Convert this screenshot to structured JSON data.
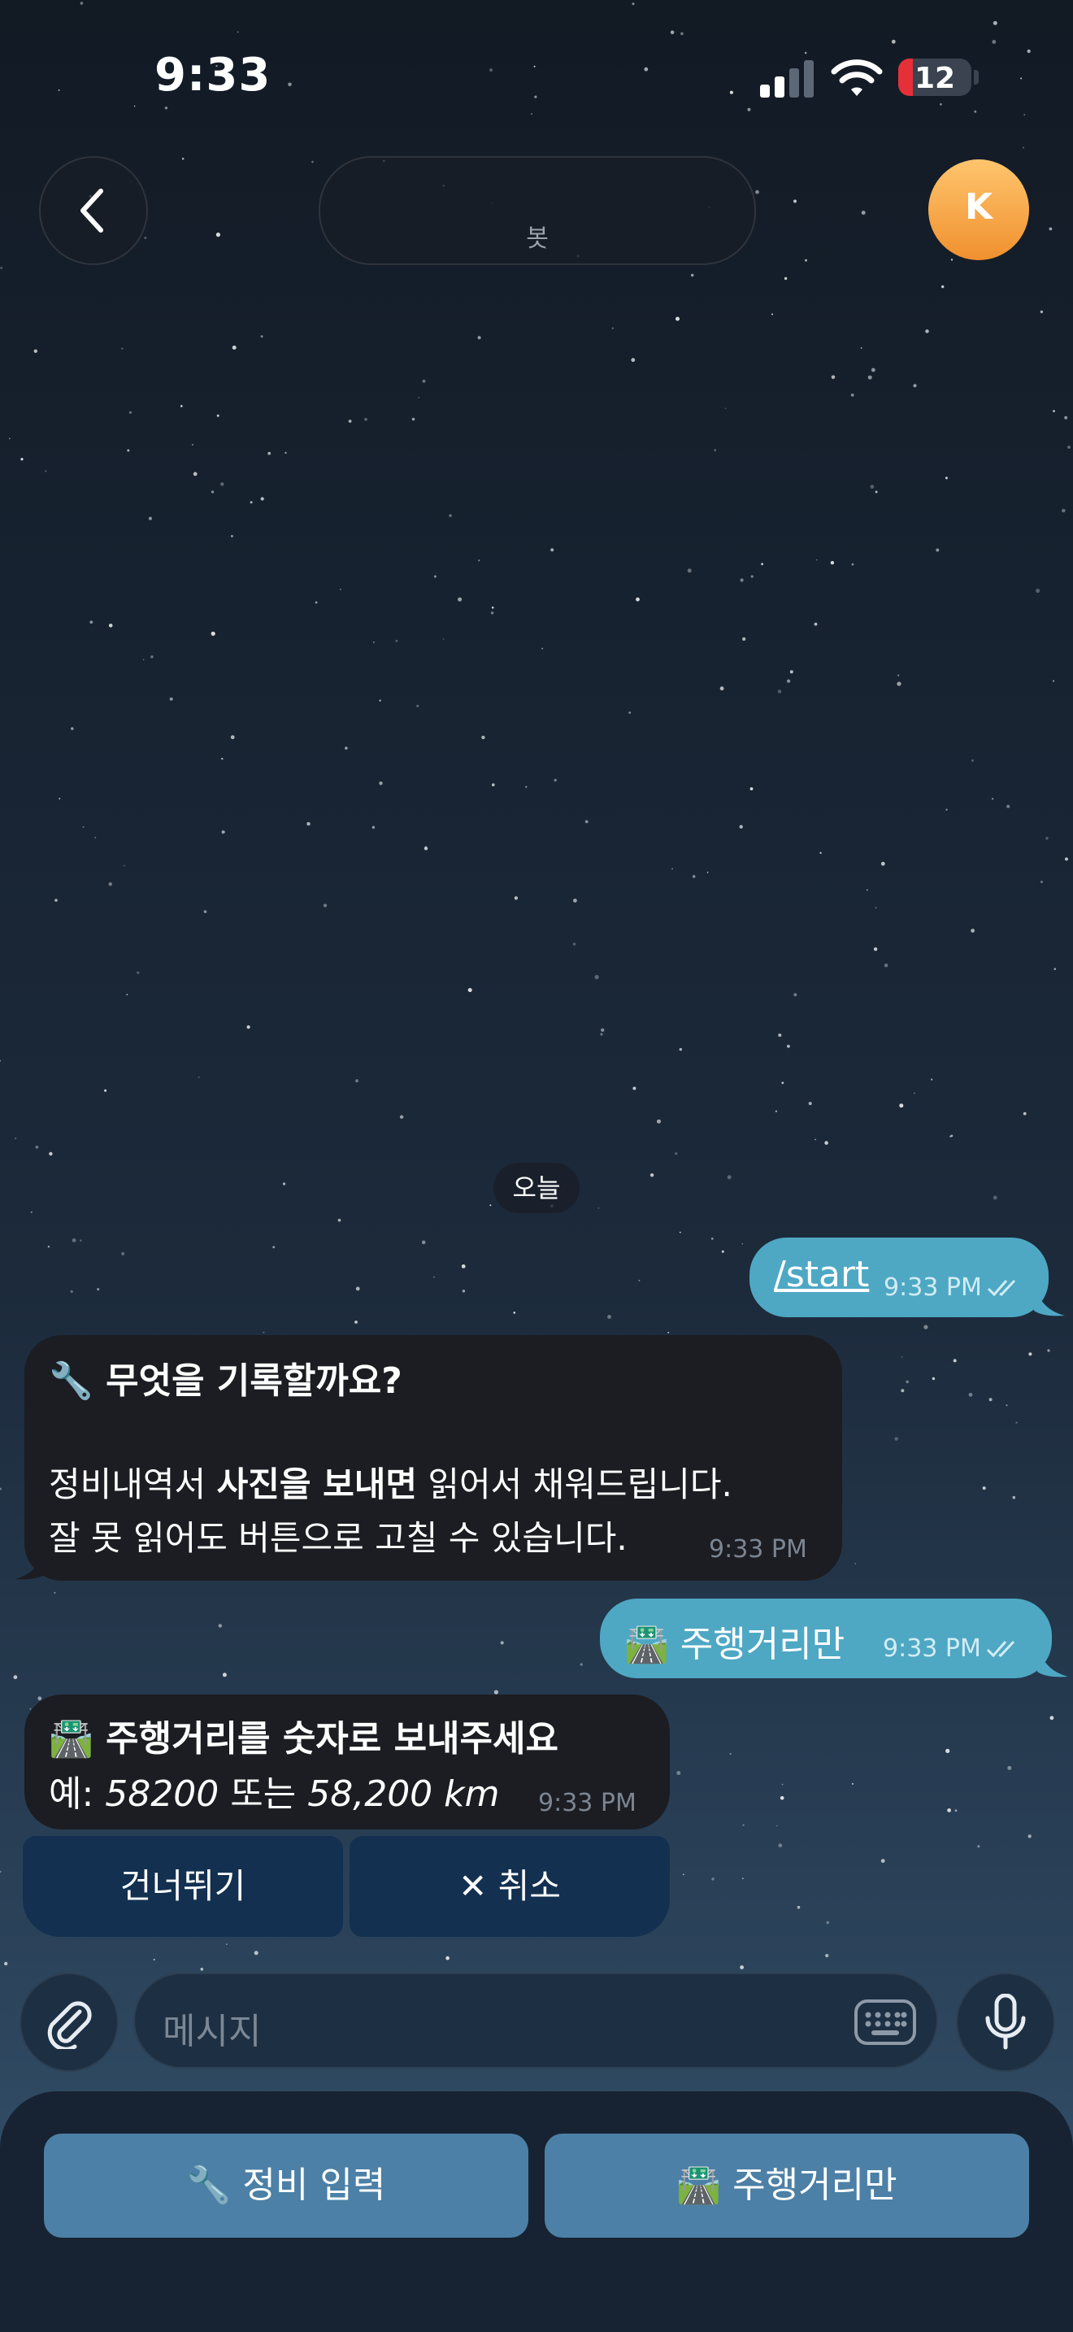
{
  "status_bar": {
    "time": "9:33",
    "battery": "12"
  },
  "header": {
    "title": "봇",
    "avatar_initial": "K"
  },
  "date_divider": "오늘",
  "messages": [
    {
      "direction": "out",
      "text": "/start",
      "time": "9:33 PM"
    },
    {
      "direction": "in",
      "title": "🔧 무엇을 기록할까요?",
      "line2_a": "정비내역서 ",
      "line2_bold": "사진을 보내면",
      "line2_b": " 읽어서 채워드립니다.",
      "line3": "잘 못 읽어도 버튼으로 고칠 수 있습니다.",
      "time": "9:33 PM"
    },
    {
      "direction": "out",
      "text": "🛣️ 주행거리만",
      "time": "9:33 PM"
    },
    {
      "direction": "in",
      "title": "🛣️ 주행거리를 숫자로 보내주세요",
      "line2_a": "예: ",
      "line2_italic1": "58200",
      "line2_mid": " 또는 ",
      "line2_italic2": "58,200 km",
      "time": "9:33 PM"
    }
  ],
  "inline_buttons": {
    "skip": "건너뛰기",
    "cancel": "✕ 취소"
  },
  "composer": {
    "placeholder": "메시지"
  },
  "reply_keyboard": {
    "maintenance": "🔧 정비 입력",
    "mileage": "🛣️ 주행거리만"
  },
  "colors": {
    "outgoing_bubble": "#4ea8c4",
    "incoming_bubble": "#1b1d22",
    "reply_button": "#4c80a6"
  }
}
